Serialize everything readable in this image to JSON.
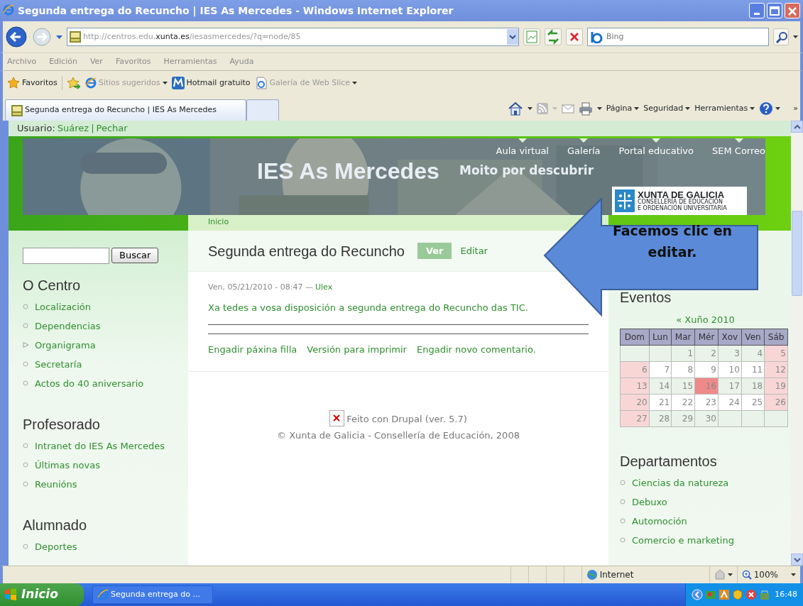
{
  "window": {
    "title": "Segunda entrega do Recuncho | IES As Mercedes - Windows Internet Explorer"
  },
  "address": {
    "url": "http://centros.edu.**xunta.es**/iesasmercedes/?q=node/85"
  },
  "search": {
    "placeholder": "Bing"
  },
  "menu": [
    "Archivo",
    "Edición",
    "Ver",
    "Favoritos",
    "Herramientas",
    "Ayuda"
  ],
  "favorites_bar": {
    "label": "Favoritos",
    "links": [
      {
        "label": "Sitios sugeridos",
        "kind": "suggested",
        "dropdown": true
      },
      {
        "label": "Hotmail gratuito",
        "kind": "hotmail",
        "dropdown": false
      },
      {
        "label": "Galería de Web Slice",
        "kind": "slice",
        "dropdown": true
      }
    ]
  },
  "tabs": [
    {
      "label": "Segunda entrega do Recuncho | IES As Mercedes",
      "selected": true
    }
  ],
  "command_bar": [
    "Página",
    "Seguridad",
    "Herramientas"
  ],
  "command_more": "»",
  "user_bar": {
    "prefix": "Usuario:",
    "user": "Suárez",
    "separator": "|",
    "logout": "Pechar"
  },
  "header": {
    "site_name": "IES As Mercedes",
    "slogan": "Moito por descubrir",
    "nav": [
      "Aula virtual",
      "Galería",
      "Portal educativo",
      "SEM Correo"
    ],
    "logo": {
      "name": "XUNTA DE GALICIA",
      "line1": "CONSELLERÍA DE EDUCACIÓN",
      "line2": "E ORDENACIÓN UNIVERSITARIA"
    }
  },
  "breadcrumb": [
    "Inicio"
  ],
  "search_form": {
    "button": "Buscar"
  },
  "left_sidebar": [
    {
      "title": "O Centro",
      "items": [
        {
          "label": "Localización",
          "kind": "leaf"
        },
        {
          "label": "Dependencias",
          "kind": "leaf"
        },
        {
          "label": "Organigrama",
          "kind": "collapsed"
        },
        {
          "label": "Secretaría",
          "kind": "leaf"
        },
        {
          "label": "Actos do 40 aniversario",
          "kind": "leaf"
        }
      ]
    },
    {
      "title": "Profesorado",
      "items": [
        {
          "label": "Intranet do IES As Mercedes",
          "kind": "leaf"
        },
        {
          "label": "Últimas novas",
          "kind": "leaf"
        },
        {
          "label": "Reunións",
          "kind": "leaf"
        }
      ]
    },
    {
      "title": "Alumnado",
      "items": [
        {
          "label": "Deportes",
          "kind": "leaf"
        }
      ]
    }
  ],
  "node": {
    "title": "Segunda entrega do Recuncho",
    "tabs": [
      {
        "label": "Ver",
        "selected": true
      },
      {
        "label": "Editar",
        "selected": false
      }
    ],
    "meta": "Ven, 05/21/2010 - 08:47 —",
    "author": "Ulex",
    "body": "Xa tedes a vosa disposición a segunda entrega do Recuncho das TIC.",
    "links": [
      "Engadir páxina filla",
      "Versión para imprimir",
      "Engadir novo comentario."
    ]
  },
  "footer": {
    "powered": "Feito con Drupal (ver. 5.7)",
    "copyright": "© Xunta de Galicia - Consellería de Educación, 2008"
  },
  "callout": {
    "text": "Facemos clic en editar."
  },
  "events": {
    "title": "Eventos",
    "nav": "« Xuño 2010",
    "weekdays": [
      "Dom",
      "Lun",
      "Mar",
      "Mér",
      "Xov",
      "Ven",
      "Sáb"
    ],
    "weeks": [
      [
        {
          "kind": "empty"
        },
        {
          "kind": "empty"
        },
        {
          "day": "1",
          "kind": "shaded"
        },
        {
          "day": "2",
          "kind": "shaded"
        },
        {
          "day": "3",
          "kind": "shaded"
        },
        {
          "day": "4",
          "kind": "shaded"
        },
        {
          "day": "5",
          "kind": "weekend"
        }
      ],
      [
        {
          "day": "6",
          "kind": "weekend"
        },
        {
          "day": "7",
          "kind": "day"
        },
        {
          "day": "8",
          "kind": "day"
        },
        {
          "day": "9",
          "kind": "day"
        },
        {
          "day": "10",
          "kind": "day"
        },
        {
          "day": "11",
          "kind": "day"
        },
        {
          "day": "12",
          "kind": "weekend"
        }
      ],
      [
        {
          "day": "13",
          "kind": "weekend"
        },
        {
          "day": "14",
          "kind": "shaded"
        },
        {
          "day": "15",
          "kind": "shaded"
        },
        {
          "day": "16",
          "kind": "today"
        },
        {
          "day": "17",
          "kind": "shaded"
        },
        {
          "day": "18",
          "kind": "shaded"
        },
        {
          "day": "19",
          "kind": "weekend"
        }
      ],
      [
        {
          "day": "20",
          "kind": "weekend"
        },
        {
          "day": "21",
          "kind": "day"
        },
        {
          "day": "22",
          "kind": "day"
        },
        {
          "day": "23",
          "kind": "day"
        },
        {
          "day": "24",
          "kind": "day"
        },
        {
          "day": "25",
          "kind": "day"
        },
        {
          "day": "26",
          "kind": "weekend"
        }
      ],
      [
        {
          "day": "27",
          "kind": "weekend"
        },
        {
          "day": "28",
          "kind": "shaded"
        },
        {
          "day": "29",
          "kind": "shaded"
        },
        {
          "day": "30",
          "kind": "shaded"
        },
        {
          "kind": "empty"
        },
        {
          "kind": "empty"
        },
        {
          "kind": "empty"
        }
      ]
    ]
  },
  "right_sidebar": [
    {
      "title": "Departamentos",
      "items": [
        {
          "label": "Ciencias da natureza",
          "kind": "leaf"
        },
        {
          "label": "Debuxo",
          "kind": "leaf"
        },
        {
          "label": "Automoción",
          "kind": "leaf"
        },
        {
          "label": "Comercio e marketing",
          "kind": "leaf"
        }
      ]
    }
  ],
  "status_bar": {
    "zone": "Internet",
    "zoom": "100%"
  },
  "taskbar": {
    "start": "Inicio",
    "tasks": [
      {
        "label": "Segunda entrega do ...",
        "selected": false
      }
    ],
    "clock": "16:48"
  }
}
